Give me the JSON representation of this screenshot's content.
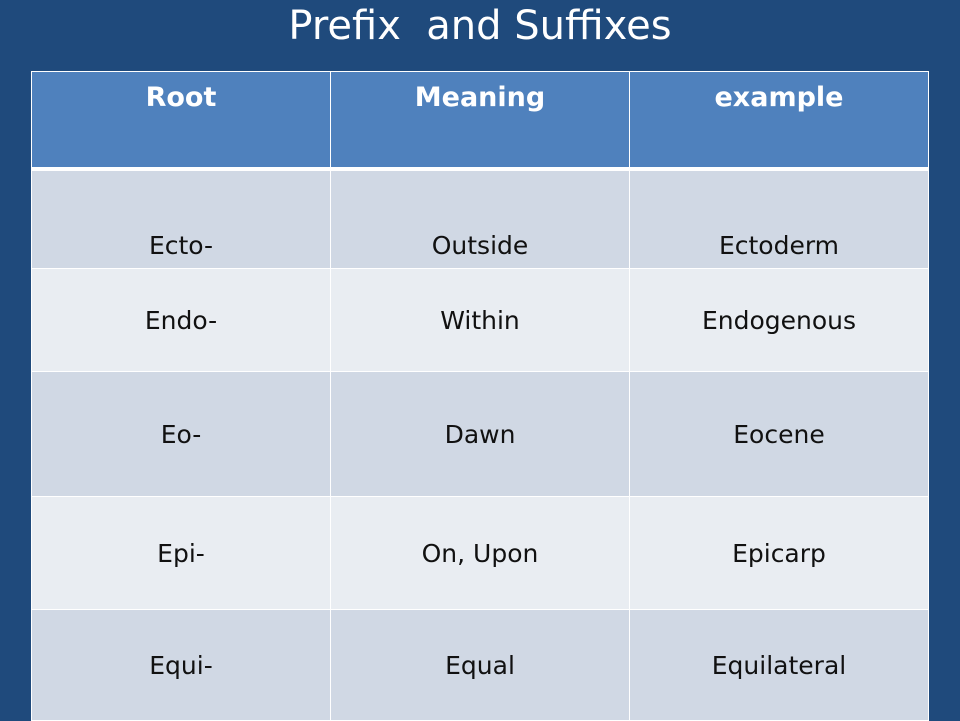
{
  "title": "Prefix  and Suffixes",
  "table": {
    "headers": [
      "Root",
      "Meaning",
      "example"
    ],
    "rows": [
      [
        "Ecto-",
        "Outside",
        "Ectoderm"
      ],
      [
        "Endo-",
        "Within",
        "Endogenous"
      ],
      [
        "Eo-",
        "Dawn",
        "Eocene"
      ],
      [
        "Epi-",
        "On, Upon",
        "Epicarp"
      ],
      [
        "Equi-",
        "Equal",
        "Equilateral"
      ]
    ]
  }
}
